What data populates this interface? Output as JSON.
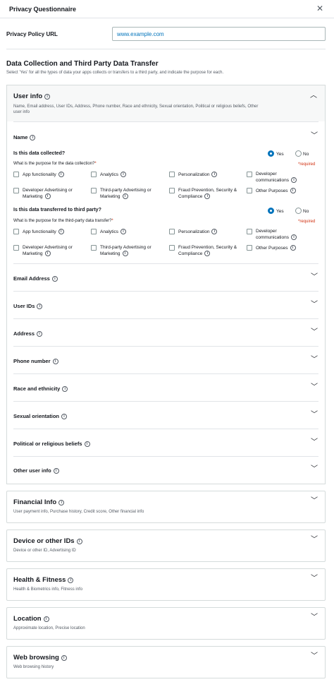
{
  "header": {
    "title": "Privacy Questionnaire",
    "close_icon": "close-icon"
  },
  "privacy_url": {
    "label": "Privacy Policy URL",
    "value": "www.example.com"
  },
  "data_section": {
    "title": "Data Collection and Third Party Data Transfer",
    "description": "Select 'Yes' for all the types of data your apps collects or transfers to a third party, and indicate the purpose for each."
  },
  "user_info": {
    "title": "User info",
    "subtitle_line1": "Name, Email address, User IDs, Address, Phone number, Race and ethnicity, Sexual orientation, Political or religious beliefs, Other",
    "subtitle_line2": "user info",
    "name_row": {
      "title": "Name",
      "collected_question": "Is this data collected?",
      "collected_purpose": "What is the purpose for the data collection?",
      "transferred_question": "Is this data transferred to third party?",
      "transferred_purpose": "What is the purpose for the third-party data transfer?",
      "required_mark": "*",
      "required_text": "*required",
      "yes": "Yes",
      "no": "No",
      "purposes": {
        "app_functionality": "App functionality",
        "analytics": "Analytics",
        "personalization": "Personalization",
        "dev_comm_1": "Developer",
        "dev_comm_2": "communications",
        "dev_adv_1": "Developer Advertising or",
        "dev_adv_2": "Marketing",
        "third_adv_1": "Third-party Advertising or",
        "third_adv_2": "Marketing",
        "fraud_1": "Fraud Prevention, Security &",
        "fraud_2": "Compliance",
        "other": "Other Purposes"
      }
    },
    "rows": [
      "Email Address",
      "User IDs",
      "Address",
      "Phone number",
      "Race and ethnicity",
      "Sexual orientation",
      "Political or religious beliefs",
      "Other user info"
    ]
  },
  "panels": [
    {
      "title": "Financial Info",
      "subtitle": "User payment info, Purchase history, Credit score, Other financial info"
    },
    {
      "title": "Device or other IDs",
      "subtitle": "Device or other ID, Advertising ID"
    },
    {
      "title": "Health & Fitness",
      "subtitle": "Health & Biometrics info, Fitness info"
    },
    {
      "title": "Location",
      "subtitle": "Approximate location, Precise location"
    },
    {
      "title": "Web browsing",
      "subtitle": "Web browsing history"
    }
  ],
  "icons": {
    "info": "info-icon",
    "expand": "chevron-down-icon",
    "collapse": "chevron-up-icon"
  },
  "colors": {
    "accent": "#0073bb",
    "required": "#d13212",
    "border": "#d5dbdb"
  }
}
